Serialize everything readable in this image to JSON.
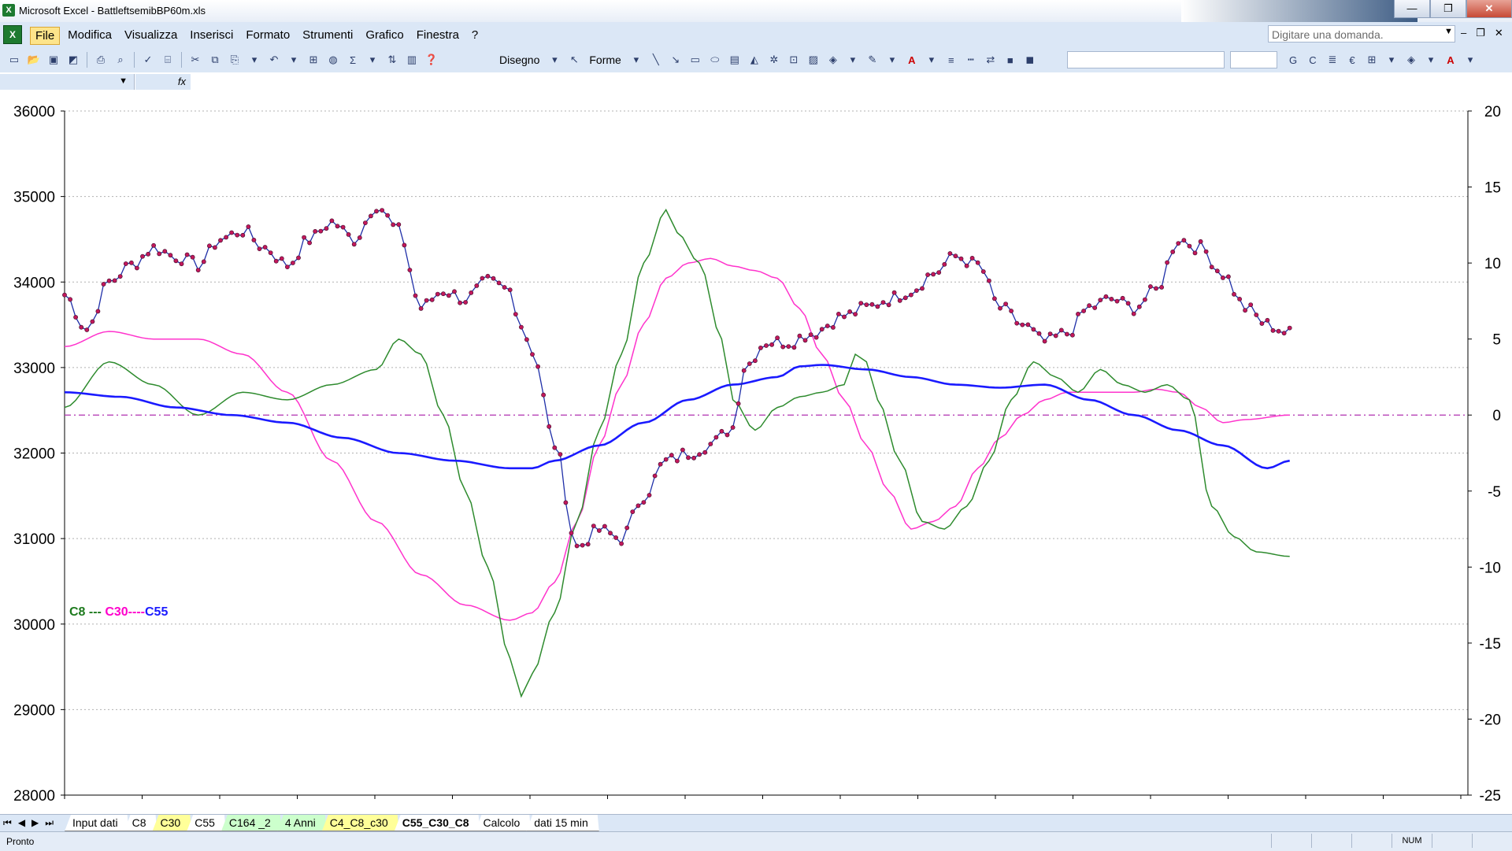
{
  "window": {
    "app_icon": "X",
    "title": "Microsoft Excel - BattleftsemibBP60m.xls",
    "controls": [
      "—",
      "❐",
      "✕"
    ]
  },
  "menu": {
    "items": [
      "File",
      "Modifica",
      "Visualizza",
      "Inserisci",
      "Formato",
      "Strumenti",
      "Grafico",
      "Finestra",
      "?"
    ],
    "ask_placeholder": "Digitare una domanda.",
    "mdi_controls": [
      "–",
      "❐",
      "✕"
    ]
  },
  "toolbar": {
    "draw_label": "Disegno",
    "shapes_label": "Forme",
    "bold_label": "G",
    "italic_label": "C",
    "euro_label": "€"
  },
  "formula_bar": {
    "fx_label": "fx"
  },
  "chart_data": {
    "type": "line",
    "left_axis": {
      "min": 28000,
      "max": 36000,
      "ticks": [
        28000,
        29000,
        30000,
        31000,
        32000,
        33000,
        34000,
        35000,
        36000
      ]
    },
    "right_axis": {
      "min": -25,
      "max": 20,
      "ticks": [
        -25,
        -20,
        -15,
        -10,
        -5,
        0,
        5,
        10,
        15,
        20
      ]
    },
    "legend": {
      "c8": "C8 --- ",
      "c30": "C30----",
      "c55": "C55"
    },
    "colors": {
      "price": "#1f2fa8",
      "price_marker": "#c2185b",
      "c8": "#2e8b2e",
      "c30": "#ff33cc",
      "c55": "#1a1aff",
      "zero_line": "#b030b0"
    },
    "x_count": 101,
    "price_key": [
      [
        0,
        33850
      ],
      [
        2,
        33450
      ],
      [
        4,
        34000
      ],
      [
        6,
        34200
      ],
      [
        8,
        34400
      ],
      [
        10,
        34300
      ],
      [
        12,
        34200
      ],
      [
        14,
        34500
      ],
      [
        16,
        34600
      ],
      [
        18,
        34400
      ],
      [
        20,
        34200
      ],
      [
        22,
        34500
      ],
      [
        24,
        34700
      ],
      [
        26,
        34500
      ],
      [
        28,
        34900
      ],
      [
        30,
        34600
      ],
      [
        32,
        33700
      ],
      [
        34,
        33900
      ],
      [
        36,
        33800
      ],
      [
        38,
        34000
      ],
      [
        40,
        33900
      ],
      [
        41,
        33500
      ],
      [
        42,
        33200
      ],
      [
        44,
        32100
      ],
      [
        46,
        30900
      ],
      [
        48,
        31100
      ],
      [
        50,
        31000
      ],
      [
        52,
        31500
      ],
      [
        54,
        31900
      ],
      [
        56,
        32000
      ],
      [
        58,
        32100
      ],
      [
        60,
        32300
      ],
      [
        61,
        33000
      ],
      [
        63,
        33300
      ],
      [
        65,
        33300
      ],
      [
        67,
        33400
      ],
      [
        70,
        33600
      ],
      [
        72,
        33700
      ],
      [
        74,
        33800
      ],
      [
        76,
        33900
      ],
      [
        78,
        34100
      ],
      [
        80,
        34300
      ],
      [
        82,
        34200
      ],
      [
        84,
        33700
      ],
      [
        86,
        33500
      ],
      [
        88,
        33300
      ],
      [
        90,
        33400
      ],
      [
        92,
        33700
      ],
      [
        94,
        33800
      ],
      [
        96,
        33700
      ],
      [
        98,
        33900
      ],
      [
        100,
        34500
      ],
      [
        102,
        34400
      ],
      [
        104,
        34100
      ],
      [
        106,
        33700
      ],
      [
        108,
        33500
      ],
      [
        110,
        33400
      ]
    ],
    "c8_key": [
      [
        0,
        0.5
      ],
      [
        4,
        3.5
      ],
      [
        8,
        2
      ],
      [
        12,
        0
      ],
      [
        16,
        1.5
      ],
      [
        20,
        1
      ],
      [
        24,
        2
      ],
      [
        28,
        3
      ],
      [
        30,
        5
      ],
      [
        32,
        4
      ],
      [
        34,
        0
      ],
      [
        36,
        -5
      ],
      [
        38,
        -10
      ],
      [
        40,
        -16
      ],
      [
        41,
        -18.5
      ],
      [
        42,
        -17
      ],
      [
        44,
        -13
      ],
      [
        46,
        -7
      ],
      [
        48,
        -1
      ],
      [
        50,
        4
      ],
      [
        52,
        10
      ],
      [
        54,
        13.5
      ],
      [
        55,
        12
      ],
      [
        57,
        10
      ],
      [
        59,
        5
      ],
      [
        60,
        1
      ],
      [
        62,
        -1
      ],
      [
        64,
        0.5
      ],
      [
        66,
        1.2
      ],
      [
        68,
        1.5
      ],
      [
        70,
        2
      ],
      [
        71,
        4
      ],
      [
        72,
        3.5
      ],
      [
        73,
        1
      ],
      [
        75,
        -3
      ],
      [
        77,
        -7
      ],
      [
        79,
        -7.5
      ],
      [
        81,
        -6
      ],
      [
        83,
        -3
      ],
      [
        85,
        1
      ],
      [
        87,
        3.5
      ],
      [
        89,
        2.5
      ],
      [
        91,
        1.5
      ],
      [
        93,
        3
      ],
      [
        95,
        2
      ],
      [
        97,
        1.5
      ],
      [
        99,
        2
      ],
      [
        101,
        1
      ],
      [
        103,
        -6
      ],
      [
        105,
        -8
      ],
      [
        107,
        -9
      ],
      [
        110,
        -9.3
      ]
    ],
    "c30_key": [
      [
        0,
        4.5
      ],
      [
        4,
        5.5
      ],
      [
        8,
        5
      ],
      [
        12,
        5
      ],
      [
        16,
        4
      ],
      [
        20,
        1.5
      ],
      [
        24,
        -3
      ],
      [
        28,
        -7
      ],
      [
        32,
        -10.5
      ],
      [
        36,
        -12.5
      ],
      [
        40,
        -13.5
      ],
      [
        42,
        -13
      ],
      [
        44,
        -11
      ],
      [
        46,
        -7
      ],
      [
        48,
        -2
      ],
      [
        50,
        2
      ],
      [
        52,
        6
      ],
      [
        54,
        9
      ],
      [
        56,
        10
      ],
      [
        58,
        10.3
      ],
      [
        60,
        9.8
      ],
      [
        62,
        9.5
      ],
      [
        64,
        9
      ],
      [
        66,
        7
      ],
      [
        68,
        4
      ],
      [
        70,
        1
      ],
      [
        72,
        -2
      ],
      [
        74,
        -5
      ],
      [
        76,
        -7.5
      ],
      [
        78,
        -7
      ],
      [
        80,
        -6
      ],
      [
        82,
        -3.5
      ],
      [
        84,
        -1.5
      ],
      [
        86,
        0
      ],
      [
        88,
        1
      ],
      [
        90,
        1.5
      ],
      [
        92,
        1.5
      ],
      [
        94,
        1.5
      ],
      [
        96,
        1.5
      ],
      [
        98,
        1.7
      ],
      [
        100,
        1.5
      ],
      [
        102,
        0.5
      ],
      [
        104,
        -0.5
      ],
      [
        106,
        -0.3
      ],
      [
        110,
        0
      ]
    ],
    "c55_key": [
      [
        0,
        1.5
      ],
      [
        5,
        1.2
      ],
      [
        10,
        0.5
      ],
      [
        15,
        0
      ],
      [
        20,
        -0.5
      ],
      [
        25,
        -1.5
      ],
      [
        30,
        -2.5
      ],
      [
        35,
        -3
      ],
      [
        40,
        -3.5
      ],
      [
        42,
        -3.5
      ],
      [
        44,
        -3
      ],
      [
        48,
        -2
      ],
      [
        52,
        -0.5
      ],
      [
        56,
        1
      ],
      [
        60,
        2
      ],
      [
        64,
        2.5
      ],
      [
        66,
        3.2
      ],
      [
        68,
        3.3
      ],
      [
        72,
        3
      ],
      [
        76,
        2.5
      ],
      [
        80,
        2
      ],
      [
        84,
        1.8
      ],
      [
        88,
        2
      ],
      [
        92,
        1
      ],
      [
        96,
        0
      ],
      [
        100,
        -1
      ],
      [
        104,
        -2
      ],
      [
        108,
        -3.5
      ],
      [
        110,
        -3
      ]
    ]
  },
  "sheet_nav": [
    "⏮",
    "◀",
    "▶",
    "⏭"
  ],
  "sheet_tabs": [
    {
      "label": "Input dati",
      "style": ""
    },
    {
      "label": "C8",
      "style": ""
    },
    {
      "label": "C30",
      "style": "yellow"
    },
    {
      "label": "C55",
      "style": ""
    },
    {
      "label": "C164 _2",
      "style": "green"
    },
    {
      "label": "4 Anni",
      "style": "green"
    },
    {
      "label": "C4_C8_c30",
      "style": "yellow"
    },
    {
      "label": "C55_C30_C8",
      "style": "active"
    },
    {
      "label": "Calcolo",
      "style": ""
    },
    {
      "label": "dati 15 min",
      "style": ""
    }
  ],
  "status": {
    "text": "Pronto",
    "num": "NUM"
  }
}
